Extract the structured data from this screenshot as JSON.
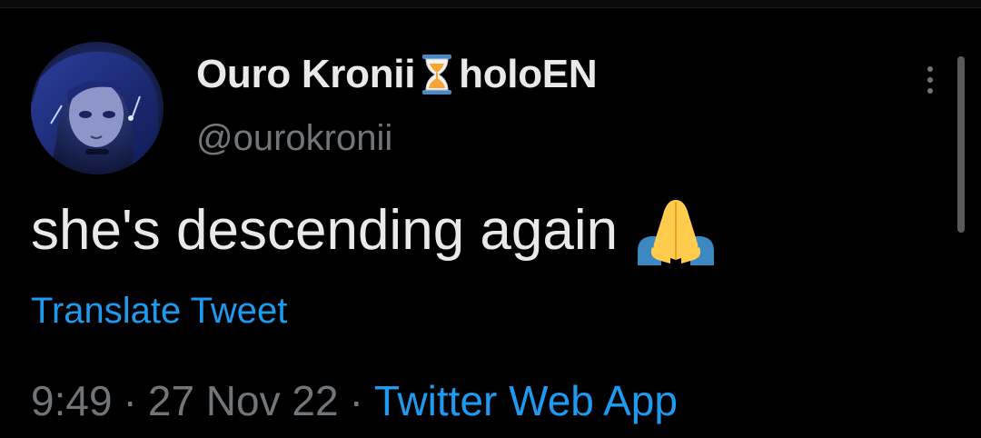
{
  "tweet": {
    "author": {
      "display_name": "Ouro Kronii",
      "affiliation": "holoEN",
      "handle": "@ourokronii",
      "name_emoji_icon": "hourglass-icon",
      "avatar_icon": "avatar-image"
    },
    "text": "she's descending again",
    "text_emoji_icon": "folded-hands-icon",
    "translate_label": "Translate Tweet",
    "time": "9:49",
    "date": "27 Nov 22",
    "separator": "·",
    "source": "Twitter Web App",
    "more_icon": "more-vertical-icon"
  },
  "colors": {
    "background": "#000000",
    "text_primary": "#e7e9ea",
    "text_secondary": "#71767b",
    "link": "#1d9bf0"
  }
}
